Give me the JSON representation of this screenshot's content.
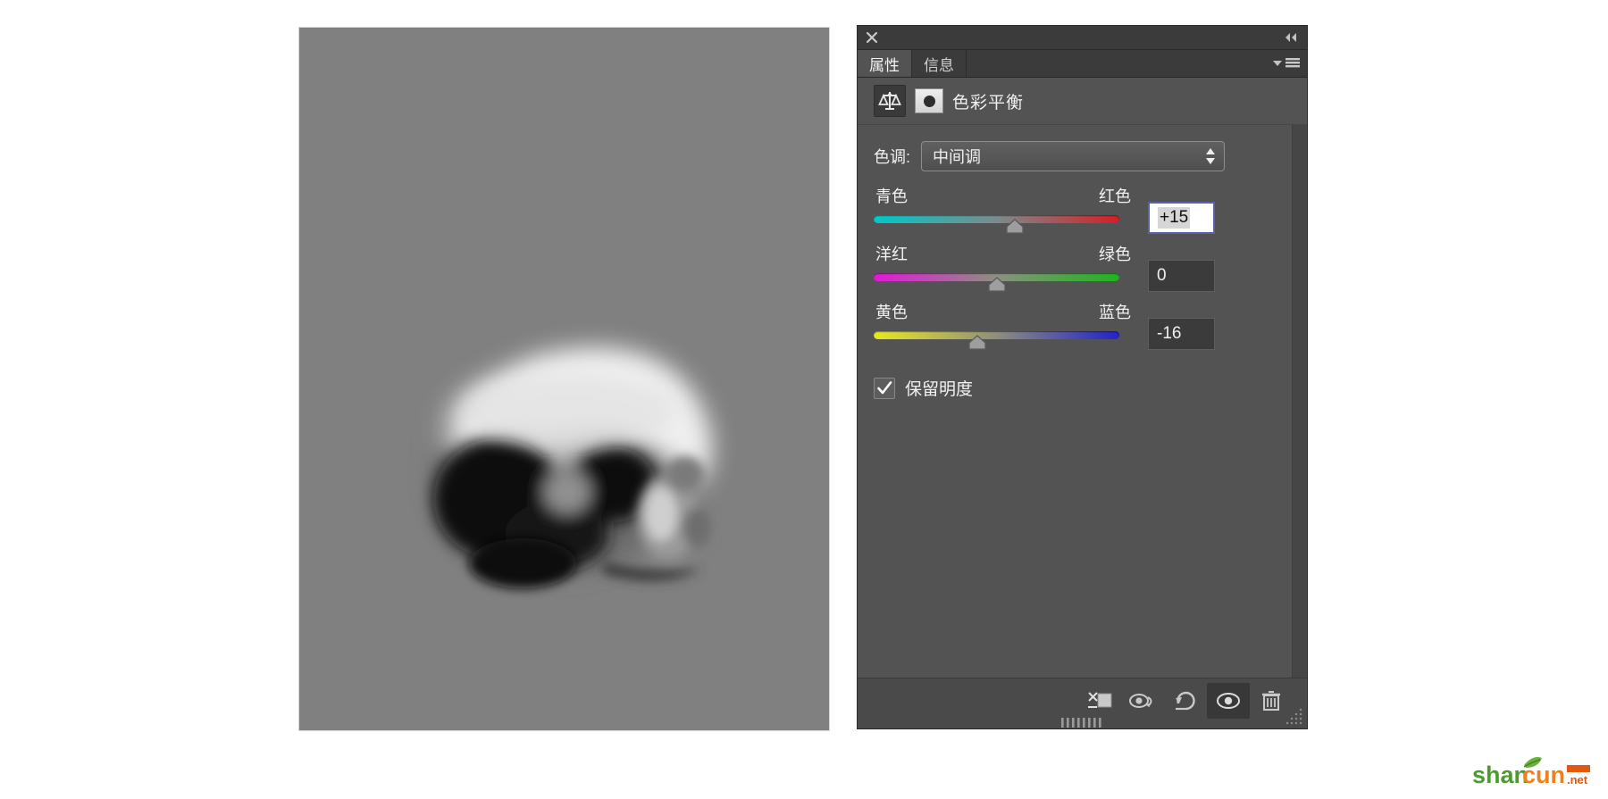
{
  "document": {
    "canvas_background": "#808080",
    "image_description": "blurred-grayscale-skull"
  },
  "panel": {
    "titlebar": {
      "close_icon": "close-icon",
      "collapse_icon": "collapse-double-chevron-icon"
    },
    "tabs": [
      {
        "label": "属性",
        "active": true
      },
      {
        "label": "信息",
        "active": false
      }
    ],
    "menu_icon": "panel-menu-icon",
    "adjustment": {
      "icon": "balance-scale-icon",
      "mask_thumbnail": "layer-mask-thumbnail",
      "title": "色彩平衡"
    },
    "tone": {
      "label": "色调:",
      "value": "中间调",
      "stepper_icon": "stepper-arrows-icon"
    },
    "sliders": [
      {
        "name": "cyan-red",
        "left_label": "青色",
        "right_label": "红色",
        "value": "+15",
        "position_percent": 57.5,
        "focused": true
      },
      {
        "name": "magenta-green",
        "left_label": "洋红",
        "right_label": "绿色",
        "value": "0",
        "position_percent": 50,
        "focused": false
      },
      {
        "name": "yellow-blue",
        "left_label": "黄色",
        "right_label": "蓝色",
        "value": "-16",
        "position_percent": 42,
        "focused": false
      }
    ],
    "preserve_luminosity": {
      "label": "保留明度",
      "checked": true
    },
    "footer": {
      "clip_to_layer_icon": "clip-to-layer-icon",
      "view_previous_state_icon": "view-previous-state-icon",
      "reset_icon": "reset-icon",
      "toggle_visibility_icon": "eye-visibility-icon",
      "delete_icon": "trash-icon",
      "resize_grip_icon": "resize-grip-icon",
      "drag_grip_icon": "drag-grip-icon"
    }
  },
  "watermark": {
    "text_first": "shan",
    "text_second": "cun",
    "suffix": ".net",
    "color_first": "#4d9b2f",
    "color_second": "#f08019"
  }
}
